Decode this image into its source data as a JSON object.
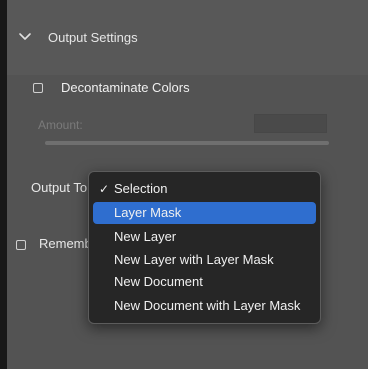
{
  "section": {
    "title": "Output Settings"
  },
  "decontaminate": {
    "label": "Decontaminate Colors",
    "checked": false
  },
  "amount": {
    "label": "Amount:",
    "value": ""
  },
  "output_to": {
    "label": "Output To:",
    "options": [
      "Selection",
      "Layer Mask",
      "New Layer",
      "New Layer with Layer Mask",
      "New Document",
      "New Document with Layer Mask"
    ],
    "checked_index": 0,
    "highlighted_index": 1
  },
  "remember": {
    "label": "Remember Settings",
    "checked": false
  },
  "icons": {
    "collapse": "chevron-down-icon",
    "check": "checkmark-icon"
  },
  "colors": {
    "panel": "#535353",
    "menu_bg": "#262626",
    "highlight": "#2f6ecf"
  }
}
